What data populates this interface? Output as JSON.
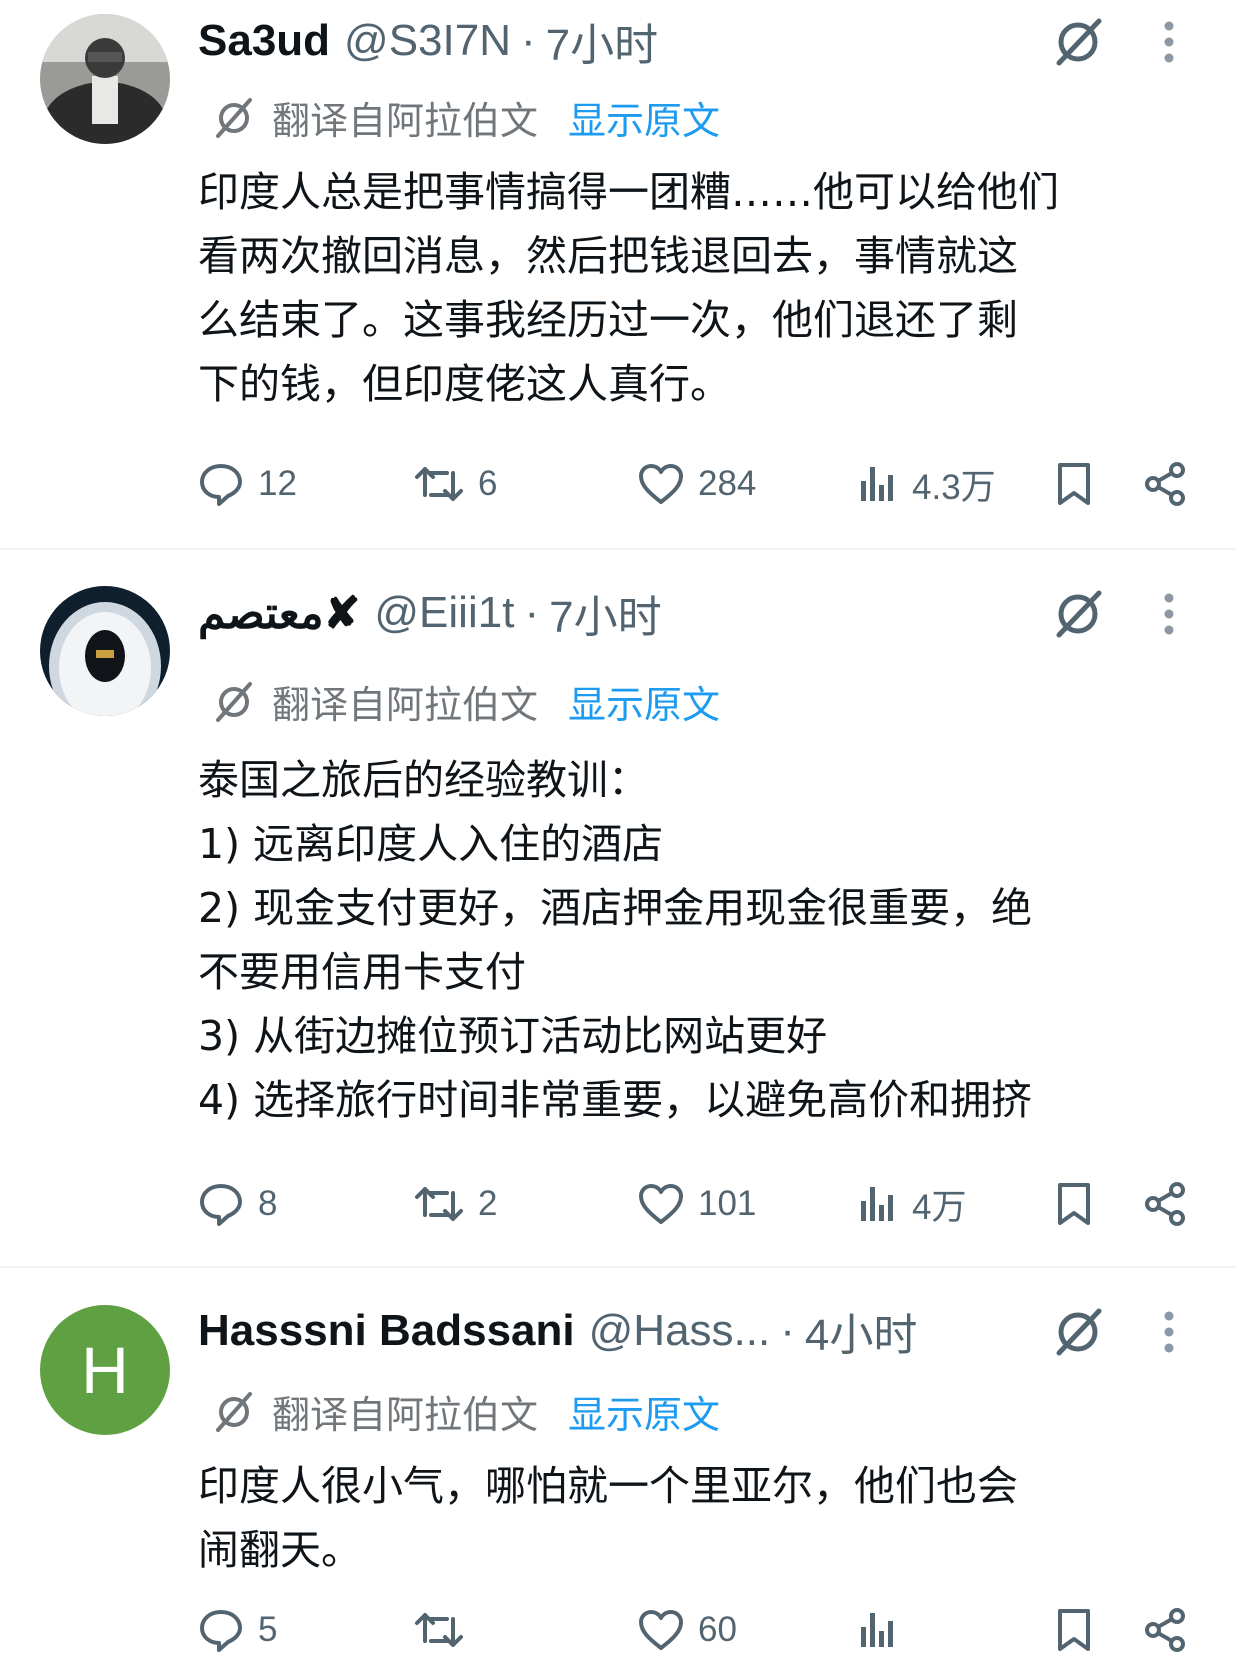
{
  "tweets": [
    {
      "name": "Sa3ud",
      "handle": "@S3I7N",
      "dot": "·",
      "time": "7小时",
      "translation_label": "翻译自阿拉伯文",
      "show_original": "显示原文",
      "text": "印度人总是把事情搞得一团糟……他可以给他们\n看两次撤回消息，然后把钱退回去，事情就这\n么结束了。这事我经历过一次，他们退还了剩\n下的钱，但印度佬这人真行。",
      "replies": "12",
      "retweets": "6",
      "likes": "284",
      "views": "4.3万"
    },
    {
      "name": "معتصم✘",
      "handle": "@Eiii1t",
      "dot": "·",
      "time": "7小时",
      "translation_label": "翻译自阿拉伯文",
      "show_original": "显示原文",
      "text": "泰国之旅后的经验教训：\n1) 远离印度人入住的酒店\n2) 现金支付更好，酒店押金用现金很重要，绝\n不要用信用卡支付\n3) 从街边摊位预订活动比网站更好\n4) 选择旅行时间非常重要，以避免高价和拥挤",
      "replies": "8",
      "retweets": "2",
      "likes": "101",
      "views": "4万"
    },
    {
      "name": "Hasssni Badssani",
      "handle": "@Hass...",
      "dot": "·",
      "time": "4小时",
      "avatar_letter": "H",
      "translation_label": "翻译自阿拉伯文",
      "show_original": "显示原文",
      "text": "印度人很小气，哪怕就一个里亚尔，他们也会\n闹翻天。",
      "replies": "5",
      "likes": "60"
    }
  ],
  "colors": {
    "link": "#1d9bf0",
    "secondary_text": "#536471",
    "avatar_green": "#5fa142"
  },
  "icons": [
    "grok-icon",
    "more-icon",
    "translate-icon",
    "reply-icon",
    "retweet-icon",
    "like-icon",
    "views-icon",
    "bookmark-icon",
    "share-icon"
  ]
}
